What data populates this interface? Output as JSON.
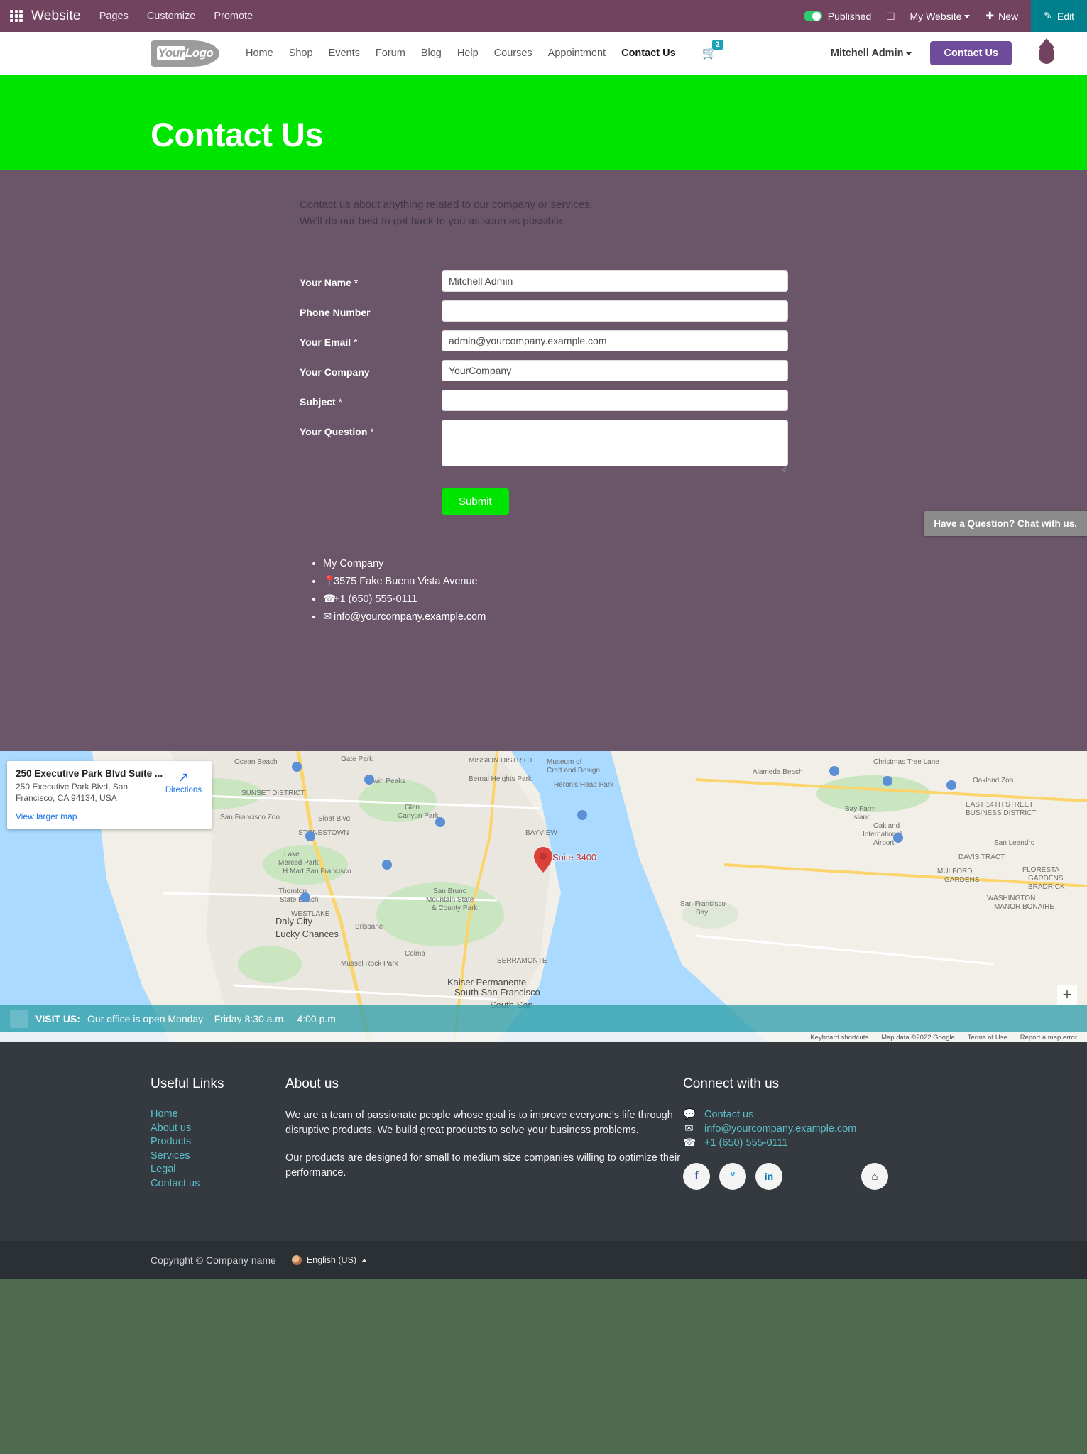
{
  "odoo_bar": {
    "apps_icon": "apps-grid-icon",
    "brand": "Website",
    "menus": [
      "Pages",
      "Customize",
      "Promote"
    ],
    "published_label": "Published",
    "mobile_icon": "mobile-preview-icon",
    "site_selector": "My Website",
    "new_label": "New",
    "new_icon": "plus-icon",
    "edit_label": "Edit",
    "edit_icon": "pencil-icon",
    "accent": "#71435f",
    "edit_accent": "#00808c"
  },
  "site_nav": {
    "logo_text_1": "Your",
    "logo_text_2": "Logo",
    "links": [
      {
        "label": "Home",
        "active": false
      },
      {
        "label": "Shop",
        "active": false
      },
      {
        "label": "Events",
        "active": false
      },
      {
        "label": "Forum",
        "active": false
      },
      {
        "label": "Blog",
        "active": false
      },
      {
        "label": "Help",
        "active": false
      },
      {
        "label": "Courses",
        "active": false
      },
      {
        "label": "Appointment",
        "active": false
      },
      {
        "label": "Contact Us",
        "active": true
      }
    ],
    "cart_icon": "shopping-cart-icon",
    "cart_count": "2",
    "user_name": "Mitchell Admin",
    "cta_label": "Contact Us",
    "brand_drop_icon": "water-drop-logo-icon"
  },
  "hero": {
    "title": "Contact Us",
    "bg_color": "#00e500"
  },
  "intro": {
    "line1": "Contact us about anything related to our company or services.",
    "line2": "We'll do our best to get back to you as soon as possible."
  },
  "form": {
    "fields": [
      {
        "label": "Your Name",
        "required": true,
        "value": "Mitchell Admin",
        "placeholder": "",
        "type": "text"
      },
      {
        "label": "Phone Number",
        "required": false,
        "value": "",
        "placeholder": "",
        "type": "text"
      },
      {
        "label": "Your Email",
        "required": true,
        "value": "admin@yourcompany.example.com",
        "placeholder": "",
        "type": "text"
      },
      {
        "label": "Your Company",
        "required": false,
        "value": "YourCompany",
        "placeholder": "",
        "type": "text"
      },
      {
        "label": "Subject",
        "required": true,
        "value": "",
        "placeholder": "",
        "type": "text"
      },
      {
        "label": "Your Question",
        "required": true,
        "value": "",
        "placeholder": "",
        "type": "textarea"
      }
    ],
    "submit_label": "Submit",
    "required_mark": "*"
  },
  "contact_list": {
    "company": "My Company",
    "address": "3575 Fake Buena Vista Avenue",
    "phone": "+1 (650) 555-0111",
    "email": "info@yourcompany.example.com",
    "address_icon": "map-pin-icon",
    "phone_icon": "phone-icon",
    "email_icon": "envelope-icon"
  },
  "chat": {
    "label": "Have a Question? Chat with us."
  },
  "map": {
    "card_title": "250 Executive Park Blvd Suite ...",
    "card_address_line1": "250 Executive Park Blvd, San",
    "card_address_line2": "Francisco, CA 94134, USA",
    "view_larger": "View larger map",
    "directions_label": "Directions",
    "directions_icon": "directions-arrow-icon",
    "pin_label": "Suite 3400",
    "pin_icon": "map-marker-icon",
    "zoom_in_label": "+",
    "attribution": [
      "Keyboard shortcuts",
      "Map data ©2022 Google",
      "Terms of Use",
      "Report a map error"
    ],
    "labels": [
      "Ocean Beach",
      "Gate Park",
      "MISSION DISTRICT",
      "Museum of Craft and Design",
      "Christmas Tree Lane",
      "Alameda Beach",
      "Oakland Zoo",
      "Twin Peaks",
      "Bernal Heights Park",
      "Heron's Head Park",
      "SUNSET DISTRICT",
      "EAST 14TH STREET BUSINESS DISTRICT",
      "San Francisco Zoo",
      "Glen Canyon Park",
      "Bay Farm Island",
      "Oakland International Airport",
      "STONESTOWN",
      "BAYVIEW",
      "Sloat Blvd",
      "San Leandro",
      "DAVIS TRACT",
      "Lake Merced Park",
      "H Mart San Francisco",
      "MULFORD GARDENS",
      "FLORESTA GARDENS",
      "BRADRICK",
      "Thornton State Beach",
      "WASHINGTON MANOR BONAIRE",
      "San Bruno Mountain State & County Park",
      "WESTLAKE",
      "Daly City",
      "Lucky Chances",
      "Brisbane",
      "San Francisco Bay",
      "Colma",
      "Mussel Rock Park",
      "SERRAMONTE",
      "Kaiser Permanente South San Francisco",
      "South San"
    ]
  },
  "visit_bar": {
    "label": "VISIT US:",
    "text": "Our office is open Monday – Friday 8:30 a.m. – 4:00 p.m."
  },
  "footer": {
    "useful_links": {
      "heading": "Useful Links",
      "items": [
        "Home",
        "About us",
        "Products",
        "Services",
        "Legal",
        "Contact us"
      ]
    },
    "about": {
      "heading": "About us",
      "p1": "We are a team of passionate people whose goal is to improve everyone's life through disruptive products. We build great products to solve your business problems.",
      "p2": "Our products are designed for small to medium size companies willing to optimize their performance."
    },
    "connect": {
      "heading": "Connect with us",
      "rows": [
        {
          "icon": "comment-icon",
          "text": "Contact us"
        },
        {
          "icon": "envelope-icon",
          "text": "info@yourcompany.example.com"
        },
        {
          "icon": "phone-icon",
          "text": "+1 (650) 555-0111"
        }
      ],
      "socials": [
        {
          "icon": "facebook-icon",
          "glyph": "f"
        },
        {
          "icon": "twitter-icon",
          "glyph": "ᵛ"
        },
        {
          "icon": "linkedin-icon",
          "glyph": "in"
        },
        {
          "icon": "home-icon",
          "glyph": "⌂"
        }
      ]
    },
    "copyright": "Copyright © Company name",
    "language": "English (US)"
  }
}
